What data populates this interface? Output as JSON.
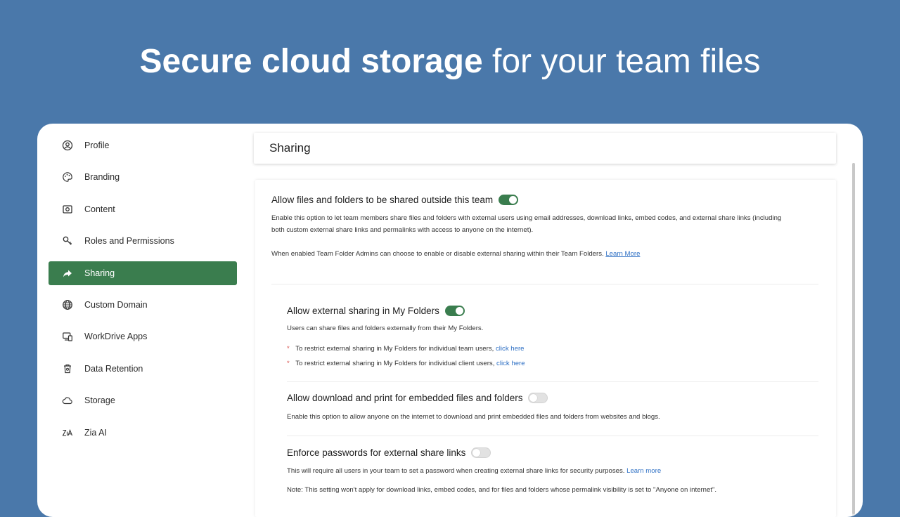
{
  "hero": {
    "bold": "Secure cloud storage",
    "light": "for your team files"
  },
  "sidebar": {
    "items": [
      {
        "label": "Profile",
        "icon": "profile-icon",
        "active": false
      },
      {
        "label": "Branding",
        "icon": "palette-icon",
        "active": false
      },
      {
        "label": "Content",
        "icon": "content-icon",
        "active": false
      },
      {
        "label": "Roles and Permissions",
        "icon": "key-icon",
        "active": false
      },
      {
        "label": "Sharing",
        "icon": "share-arrow-icon",
        "active": true
      },
      {
        "label": "Custom Domain",
        "icon": "globe-icon",
        "active": false
      },
      {
        "label": "WorkDrive Apps",
        "icon": "devices-icon",
        "active": false
      },
      {
        "label": "Data Retention",
        "icon": "trash-icon",
        "active": false
      },
      {
        "label": "Storage",
        "icon": "cloud-icon",
        "active": false
      },
      {
        "label": "Zia AI",
        "icon": "zia-icon",
        "active": false
      }
    ]
  },
  "header": {
    "title": "Sharing"
  },
  "settings": {
    "external": {
      "title": "Allow files and folders to be shared outside this team",
      "enabled": true,
      "desc_line1": "Enable this option to let team members share files and folders with external users using email addresses, download links, embed codes, and external share links (including",
      "desc_line2": "both custom external share links and permalinks with access to anyone on the internet).",
      "note": "When enabled Team Folder Admins can choose to enable or disable external sharing within their Team Folders.",
      "learn_more": "Learn More"
    },
    "my_folders": {
      "title": "Allow external sharing in My Folders",
      "enabled": true,
      "desc": "Users can share files and folders externally from their My Folders.",
      "bullet1": "To restrict external sharing in My Folders for individual team users,",
      "bullet2": "To restrict external sharing in My Folders for individual client users,",
      "click_here": "click here",
      "bullet_mark": "*"
    },
    "embed": {
      "title": "Allow download and print for embedded files and folders",
      "enabled": false,
      "desc": "Enable this option to allow anyone on the internet to download and print embedded files and folders from websites and blogs."
    },
    "passwords": {
      "title": "Enforce passwords for external share links",
      "enabled": false,
      "desc": "This will require all users in your team to set a password when creating external share links for security purposes.",
      "learn_more": "Learn more",
      "note": "Note: This setting won't apply for download links, embed codes, and for files and folders whose permalink visibility is set to \"Anyone on internet\"."
    }
  },
  "colors": {
    "background": "#4a78aa",
    "accent": "#3a7d4e",
    "link": "#2d6fc4"
  }
}
